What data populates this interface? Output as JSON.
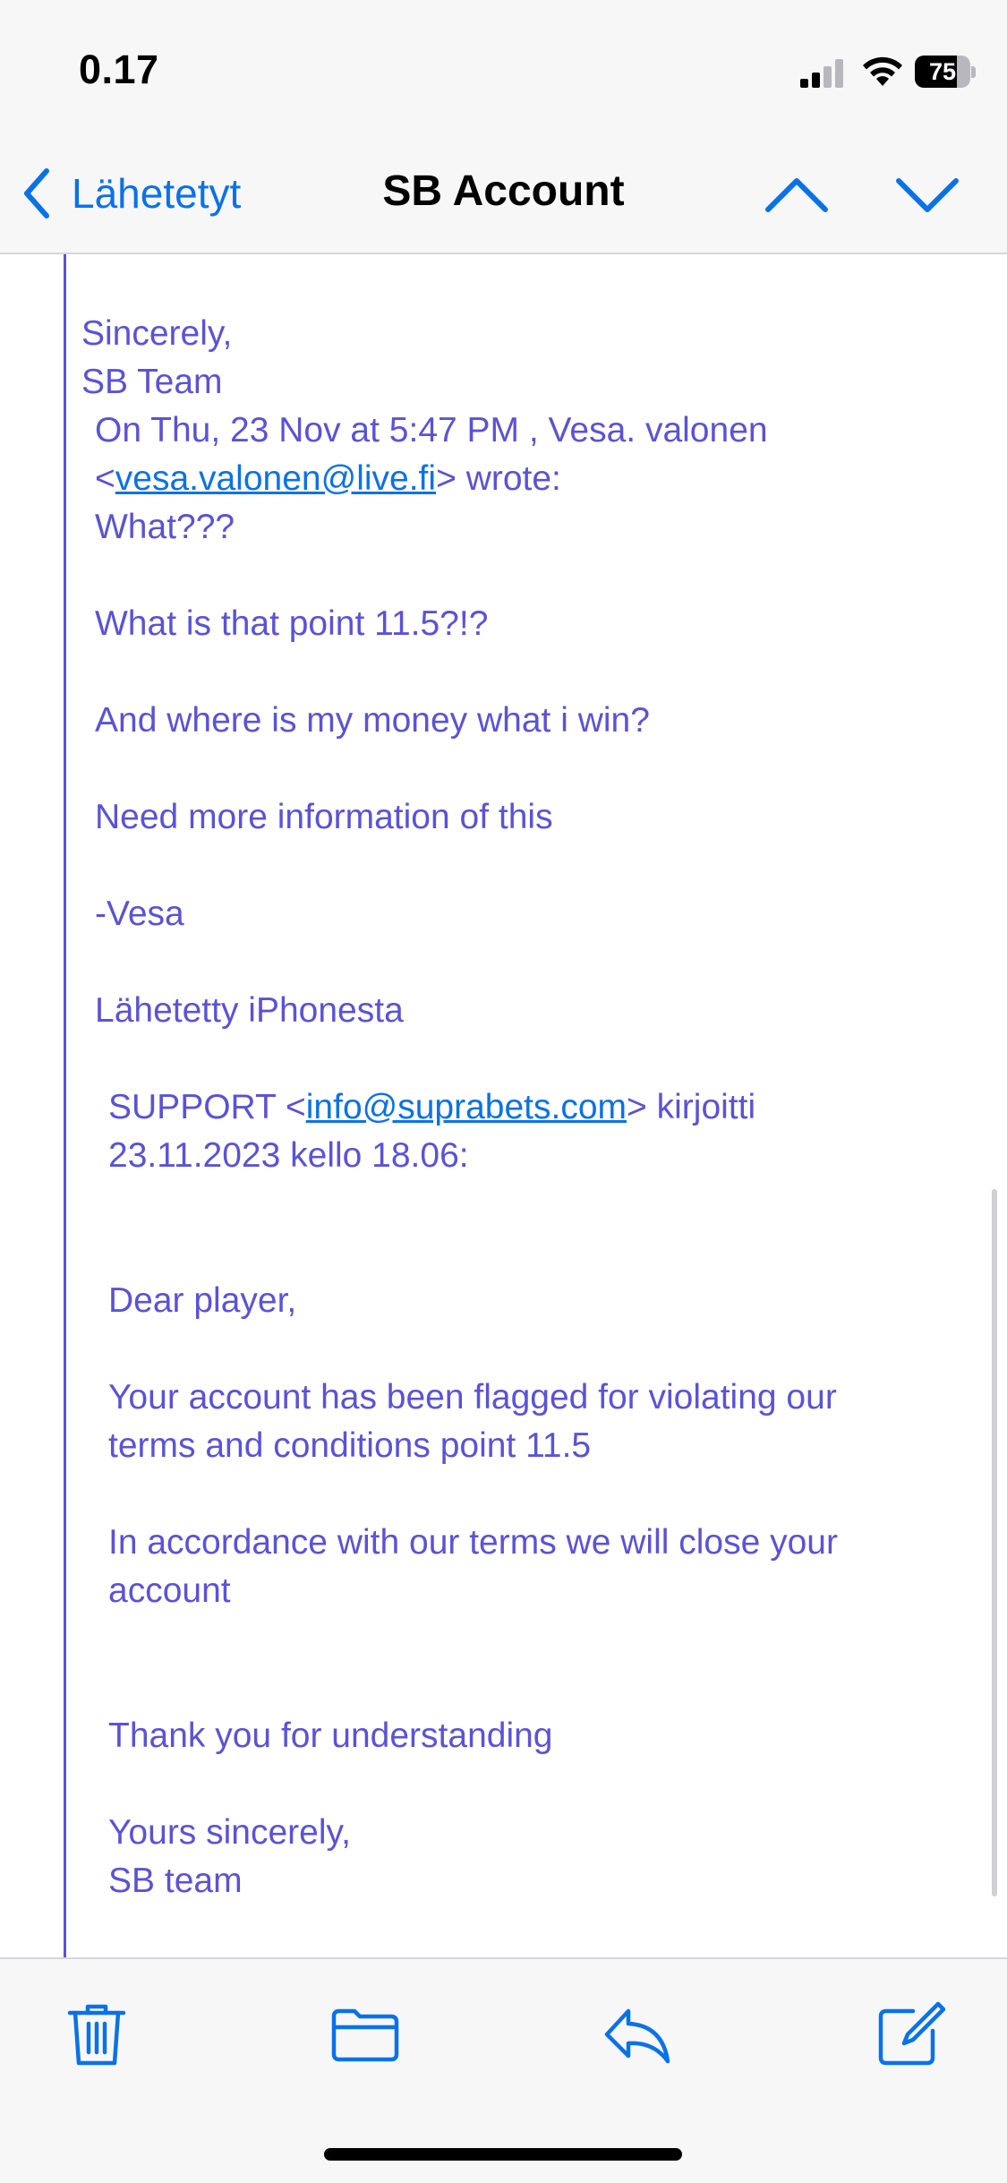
{
  "status_bar": {
    "time": "0.17",
    "battery_percent": "75",
    "battery_level": 0.75,
    "signal_bars_active": 2,
    "icons": [
      "signal-icon",
      "wifi-icon",
      "battery-icon"
    ]
  },
  "nav": {
    "back_label": "Lähetetyt",
    "title": "SB Account",
    "icons": [
      "chevron-left-icon",
      "chevron-up-icon",
      "chevron-down-icon"
    ]
  },
  "email": {
    "signoff": "Sincerely,",
    "signoff_team": "SB Team",
    "reply_header_line1": "On Thu, 23 Nov at 5:47 PM , Vesa. valonen",
    "reply_header_email": "vesa.valonen@live.fi",
    "reply_header_wrote": "wrote:",
    "vesa_line1": "What???",
    "vesa_line2": "What is that point 11.5?!?",
    "vesa_line3": "And where is my money what i win?",
    "vesa_line4": "Need more information of this",
    "vesa_line5": "-Vesa",
    "vesa_line6": "Lähetetty iPhonesta",
    "support_sender": "SUPPORT",
    "support_email": "info@suprabets.com",
    "support_wrote": "kirjoitti",
    "support_date": "23.11.2023 kello 18.06:",
    "support_greeting": "Dear player,",
    "support_para1_line1": "Your account has been flagged for violating our",
    "support_para1_line2": "terms and conditions point 11.5",
    "support_para2_line1": "In accordance with our terms we will close your",
    "support_para2_line2": "account",
    "support_thanks": "Thank you for understanding",
    "support_closing": "Yours sincerely,",
    "support_team": "SB team"
  },
  "toolbar": {
    "icons": [
      "trash-icon",
      "folder-icon",
      "reply-icon",
      "compose-icon"
    ]
  },
  "colors": {
    "accent": "#0a72e8",
    "quote_text": "#5b52d8",
    "bar_background": "#f7f7f8"
  }
}
